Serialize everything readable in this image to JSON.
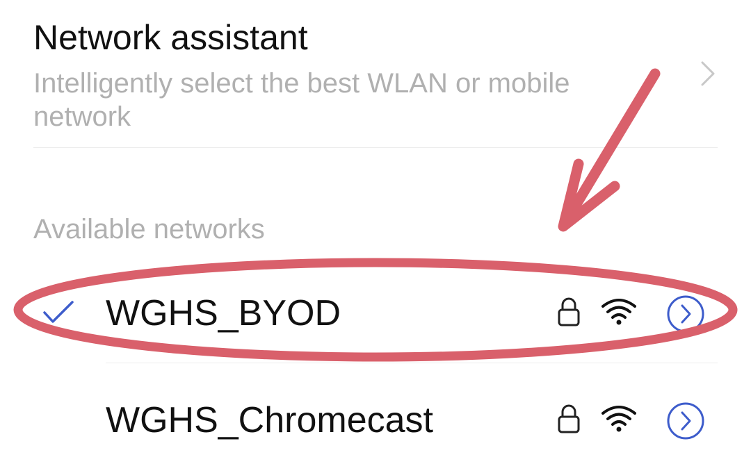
{
  "network_assistant": {
    "title": "Network assistant",
    "description": "Intelligently select the best WLAN or mobile network",
    "icon": "chevron-right-icon"
  },
  "available_networks": {
    "label": "Available networks",
    "items": [
      {
        "name": "WGHS_BYOD",
        "connected": true,
        "secured": true,
        "icons": [
          "check-icon",
          "lock-icon",
          "wifi-icon",
          "info-icon"
        ]
      },
      {
        "name": "WGHS_Chromecast",
        "connected": false,
        "secured": true,
        "icons": [
          "lock-icon",
          "wifi-icon",
          "info-icon"
        ]
      }
    ]
  },
  "colors": {
    "accent": "#3D5CCB",
    "annotation": "#D9606B",
    "secondary_text": "#B0B0B0",
    "primary_text": "#111111"
  }
}
